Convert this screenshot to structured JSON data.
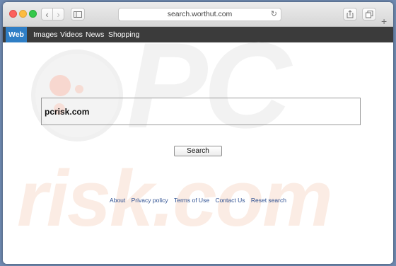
{
  "browser": {
    "url": "search.worthut.com",
    "new_tab_label": "+"
  },
  "nav": {
    "items": [
      {
        "label": "Web",
        "active": true
      },
      {
        "label": "Images",
        "active": false
      },
      {
        "label": "Videos",
        "active": false
      },
      {
        "label": "News",
        "active": false
      },
      {
        "label": "Shopping",
        "active": false
      }
    ]
  },
  "search": {
    "value": "pcrisk.com",
    "button_label": "Search"
  },
  "footer": {
    "links": [
      "About",
      "Privacy policy",
      "Terms of Use",
      "Contact Us",
      "Reset search"
    ]
  },
  "watermark": {
    "top": "PC",
    "bottom": "risk.com"
  },
  "colors": {
    "nav_background": "#3b3b3b",
    "nav_active": "#2f7ec5",
    "link": "#2d4f91"
  }
}
